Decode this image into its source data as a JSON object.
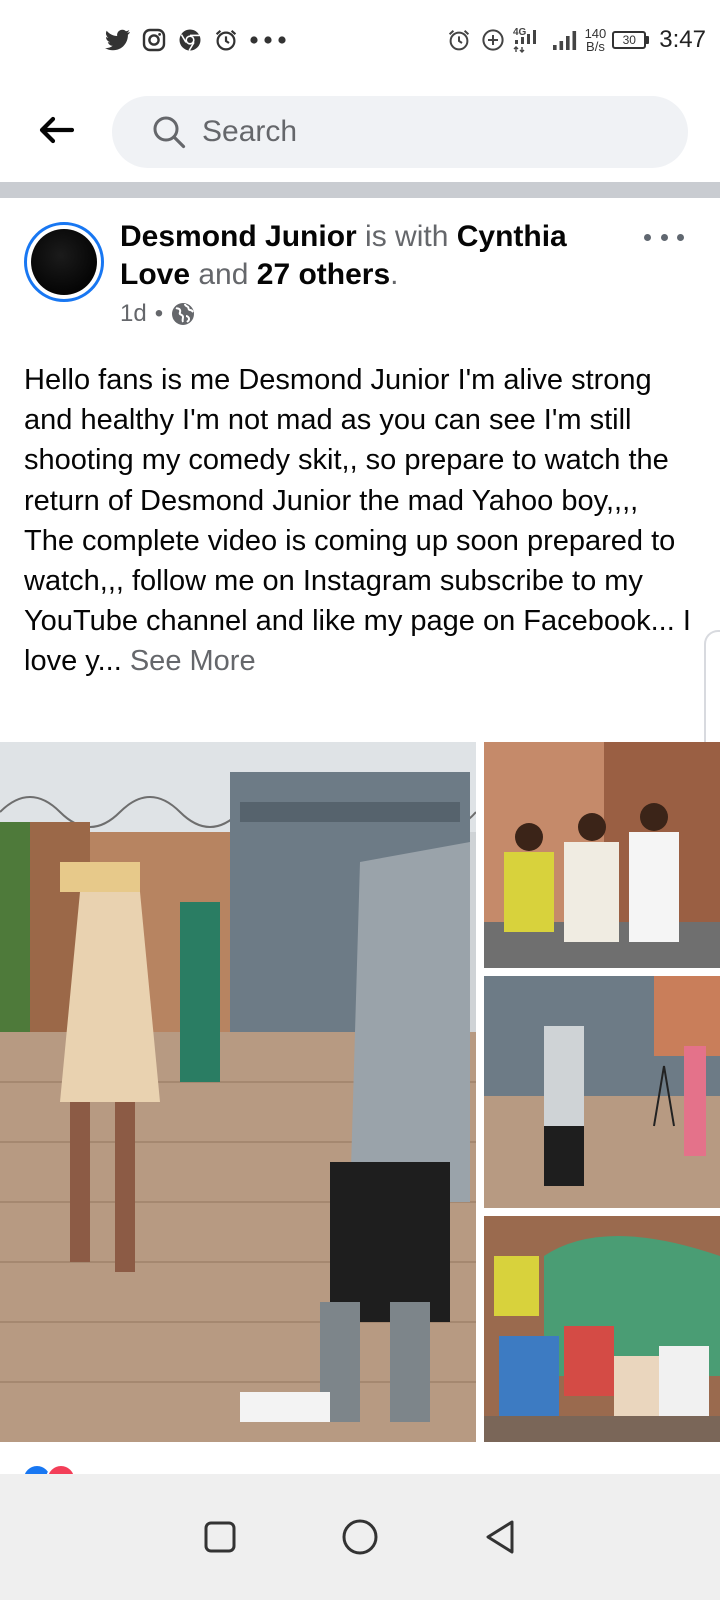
{
  "status_bar": {
    "left_icons": [
      "twitter-icon",
      "instagram-icon",
      "chrome-icon",
      "alarm-icon",
      "more-dots-icon"
    ],
    "right_icons": [
      "alarm-icon",
      "data-saver-icon",
      "signal-4g-icon",
      "signal-icon"
    ],
    "network_type": "4G",
    "speed_value": "140",
    "speed_unit": "B/s",
    "battery": "30",
    "time": "3:47"
  },
  "header": {
    "back_icon": "arrow-left-icon",
    "search_placeholder": "Search"
  },
  "post": {
    "author": "Desmond Junior",
    "with_text": " is with ",
    "tagged_name": "Cynthia Love",
    "and_text": " and ",
    "others": "27 others",
    "period": ".",
    "time": "1d",
    "separator": "•",
    "privacy_icon": "globe-icon",
    "body": "Hello fans is me Desmond Junior I'm alive strong and healthy I'm not mad as you can see I'm still shooting my comedy skit,, so prepare to watch the return of Desmond Junior the mad Yahoo boy,,,,  The complete  video is coming up soon prepared to watch,,, follow me on Instagram subscribe to my YouTube channel and like my page on Facebook... I love y...",
    "see_more": "See More",
    "photos": [
      "main-photo",
      "photo-group",
      "photo-gate",
      "photo-party"
    ]
  },
  "colors": {
    "accent": "#1877f2",
    "muted": "#65676b",
    "divider": "#c9ccd1",
    "navbar": "#efefef"
  },
  "nav_bar": {
    "items": [
      "recent-apps-icon",
      "home-icon",
      "back-icon"
    ]
  }
}
